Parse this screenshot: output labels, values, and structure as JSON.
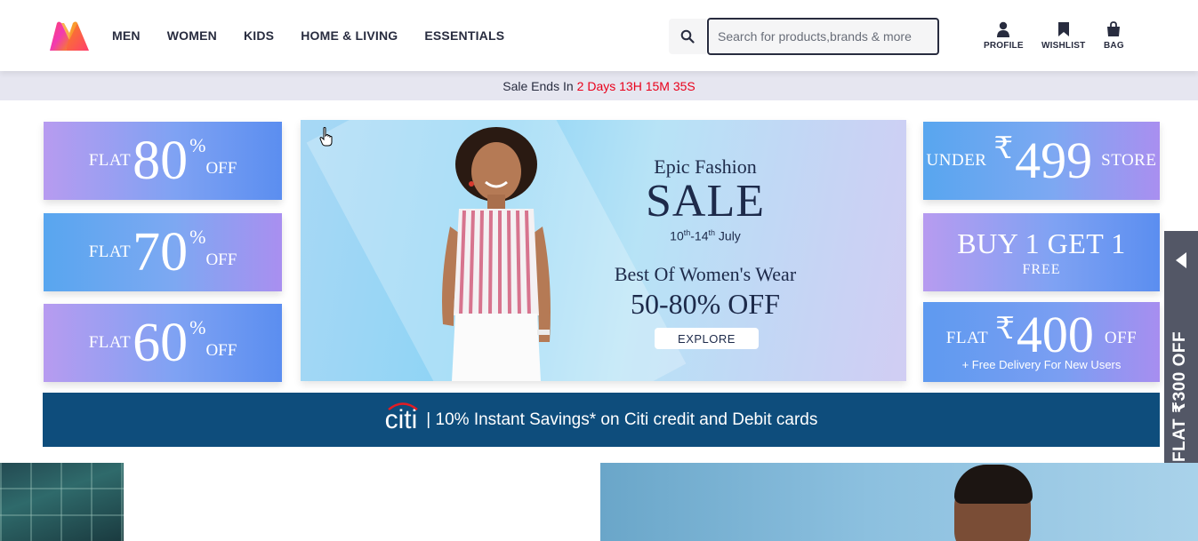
{
  "header": {
    "nav": [
      "MEN",
      "WOMEN",
      "KIDS",
      "HOME & LIVING",
      "ESSENTIALS"
    ],
    "search_placeholder": "Search for products,brands & more",
    "profile_label": "PROFILE",
    "wishlist_label": "WISHLIST",
    "bag_label": "BAG"
  },
  "sale_strip": {
    "prefix": "Sale Ends In",
    "timer": "2 Days 13H 15M 35S"
  },
  "left_tiles": [
    {
      "flat": "FLAT",
      "value": "80",
      "pct": "%",
      "off": "OFF"
    },
    {
      "flat": "FLAT",
      "value": "70",
      "pct": "%",
      "off": "OFF"
    },
    {
      "flat": "FLAT",
      "value": "60",
      "pct": "%",
      "off": "OFF"
    }
  ],
  "right_tiles": {
    "under": {
      "prefix": "UNDER",
      "rupee": "₹",
      "value": "499",
      "suffix": "STORE"
    },
    "bogo": {
      "title": "BUY 1 GET 1",
      "sub": "FREE"
    },
    "flat400": {
      "prefix": "FLAT",
      "rupee": "₹",
      "value": "400",
      "suffix": "OFF",
      "note": "+ Free Delivery For New Users"
    }
  },
  "banner": {
    "epic": "Epic Fashion",
    "sale": "SALE",
    "dates_start": "10",
    "dates_start_sup": "th",
    "dates_end": "-14",
    "dates_end_sup": "th",
    "dates_month": " July",
    "best": "Best Of Women's Wear",
    "off": "50-80% OFF",
    "explore": "EXPLORE"
  },
  "citi": {
    "logo": "citi",
    "text": "| 10% Instant Savings* on Citi credit and Debit cards"
  },
  "side_tab": {
    "text": "FLAT ₹300 OFF"
  },
  "colors": {
    "timer_red": "#e9001a",
    "citi_blue": "#0e4d7c",
    "side_tab": "#535766"
  }
}
